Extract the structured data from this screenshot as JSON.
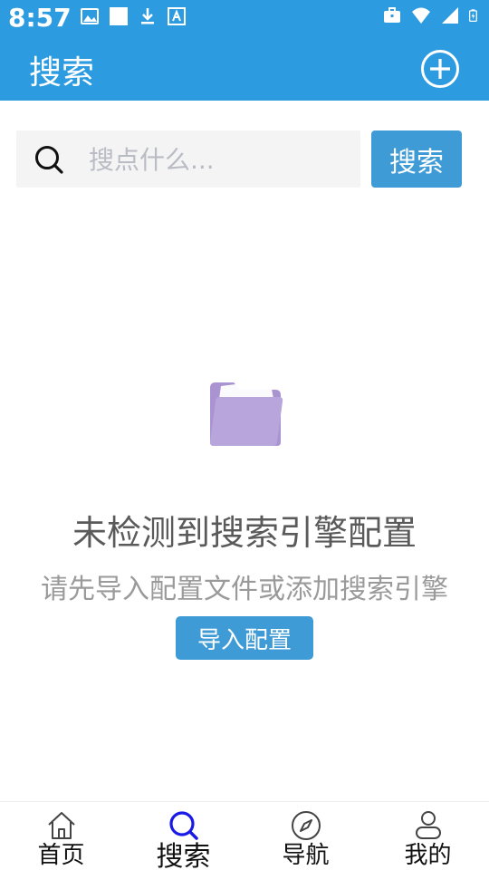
{
  "status_bar": {
    "time": "8:57",
    "left_icons": [
      "image-notification-icon",
      "blank-notification-icon",
      "download-icon",
      "font-app-icon"
    ],
    "right_icons": [
      "briefcase-icon",
      "wifi-icon",
      "signal-icon",
      "battery-charging-icon"
    ]
  },
  "app_bar": {
    "title": "搜索",
    "add_icon": "add-circle-icon"
  },
  "search": {
    "placeholder": "搜点什么...",
    "button_label": "搜索"
  },
  "empty_state": {
    "icon": "folder-icon",
    "title": "未检测到搜索引擎配置",
    "subtitle": "请先导入配置文件或添加搜索引擎",
    "button_label": "导入配置"
  },
  "bottom_nav": {
    "items": [
      {
        "label": "首页",
        "icon": "home-icon",
        "active": false
      },
      {
        "label": "搜索",
        "icon": "search-icon",
        "active": true
      },
      {
        "label": "导航",
        "icon": "compass-icon",
        "active": false
      },
      {
        "label": "我的",
        "icon": "user-icon",
        "active": false
      }
    ]
  },
  "colors": {
    "primary": "#2c9be0",
    "button": "#3f9bd6",
    "folder": "#b39ddb",
    "active_nav": "#1a1ae6"
  }
}
